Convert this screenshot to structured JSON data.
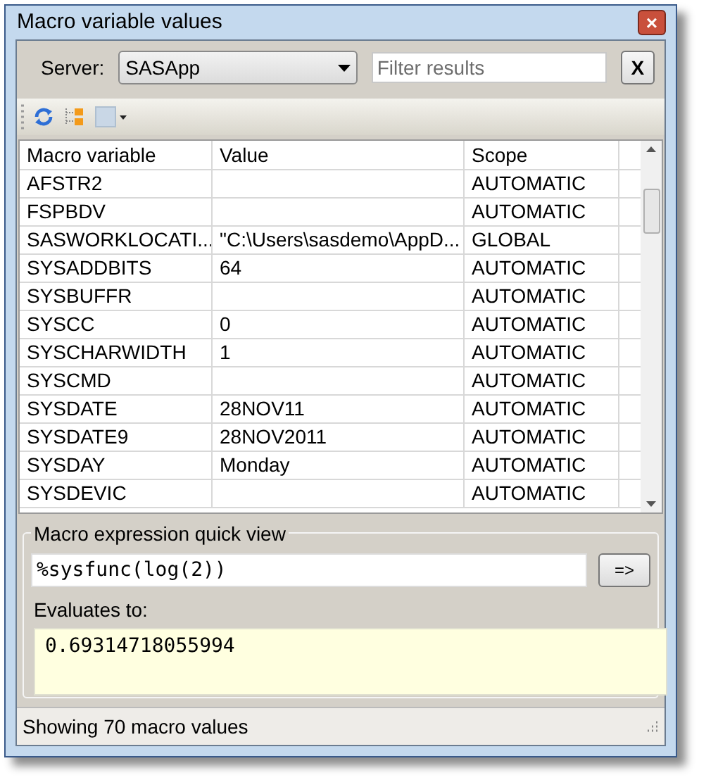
{
  "window": {
    "title": "Macro variable values",
    "close": "×"
  },
  "server": {
    "label": "Server:",
    "value": "SASApp",
    "filter_placeholder": "Filter results",
    "clear": "X"
  },
  "table": {
    "columns": [
      "Macro variable",
      "Value",
      "Scope"
    ],
    "rows": [
      {
        "name": "AFSTR2",
        "value": "",
        "scope": "AUTOMATIC"
      },
      {
        "name": "FSPBDV",
        "value": "",
        "scope": "AUTOMATIC"
      },
      {
        "name": "SASWORKLOCATI...",
        "value": "\"C:\\Users\\sasdemo\\AppD...",
        "scope": "GLOBAL"
      },
      {
        "name": "SYSADDBITS",
        "value": "64",
        "scope": "AUTOMATIC"
      },
      {
        "name": "SYSBUFFR",
        "value": "",
        "scope": "AUTOMATIC"
      },
      {
        "name": "SYSCC",
        "value": "0",
        "scope": "AUTOMATIC"
      },
      {
        "name": "SYSCHARWIDTH",
        "value": "1",
        "scope": "AUTOMATIC"
      },
      {
        "name": "SYSCMD",
        "value": "",
        "scope": "AUTOMATIC"
      },
      {
        "name": "SYSDATE",
        "value": "28NOV11",
        "scope": "AUTOMATIC"
      },
      {
        "name": "SYSDATE9",
        "value": "28NOV2011",
        "scope": "AUTOMATIC"
      },
      {
        "name": "SYSDAY",
        "value": "Monday",
        "scope": "AUTOMATIC"
      },
      {
        "name": "SYSDEVIC",
        "value": "",
        "scope": "AUTOMATIC"
      }
    ]
  },
  "quick_view": {
    "title": "Macro expression quick view",
    "expression": "%sysfunc(log(2))",
    "button": "=>",
    "result_label": "Evaluates to:",
    "result": "0.69314718055994"
  },
  "status_bar": "Showing 70 macro values"
}
